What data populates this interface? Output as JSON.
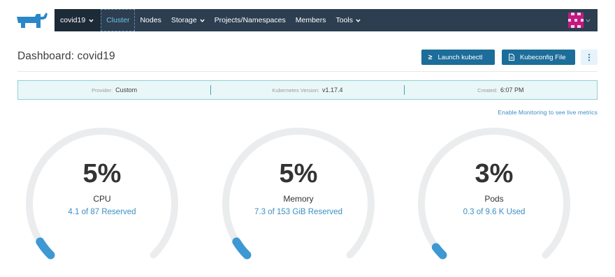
{
  "nav": {
    "cluster_name": "covid19",
    "items": [
      {
        "label": "Cluster",
        "active": true,
        "dropdown": false
      },
      {
        "label": "Nodes",
        "active": false,
        "dropdown": false
      },
      {
        "label": "Storage",
        "active": false,
        "dropdown": true
      },
      {
        "label": "Projects/Namespaces",
        "active": false,
        "dropdown": false
      },
      {
        "label": "Members",
        "active": false,
        "dropdown": false
      },
      {
        "label": "Tools",
        "active": false,
        "dropdown": true
      }
    ]
  },
  "header": {
    "title": "Dashboard: covid19",
    "launch_kubectl": "Launch kubectl",
    "kubeconfig_file": "Kubeconfig File",
    "more": "⋮"
  },
  "info": {
    "provider_label": "Provider:",
    "provider_value": "Custom",
    "version_label": "Kubernetes Version:",
    "version_value": "v1.17.4",
    "created_label": "Created:",
    "created_value": "6:07 PM"
  },
  "monitoring_link": "Enable Monitoring to see live metrics",
  "gauges": [
    {
      "percent_label": "5%",
      "percent": 5,
      "name": "CPU",
      "detail": "4.1 of 87 Reserved"
    },
    {
      "percent_label": "5%",
      "percent": 5,
      "name": "Memory",
      "detail": "7.3 of 153 GiB Reserved"
    },
    {
      "percent_label": "3%",
      "percent": 3,
      "name": "Pods",
      "detail": "0.3 of 9.6 K Used"
    }
  ],
  "colors": {
    "nav_bg": "#2c3e50",
    "accent": "#1c6d99",
    "link": "#3a8fc4",
    "gauge_track": "#ebeced",
    "gauge_fill": "#3d98d3",
    "info_bg": "#eaf7f8"
  },
  "icons": {
    "logo": "rancher-logo",
    "kubectl": "terminal-icon",
    "kubeconfig": "file-icon"
  }
}
